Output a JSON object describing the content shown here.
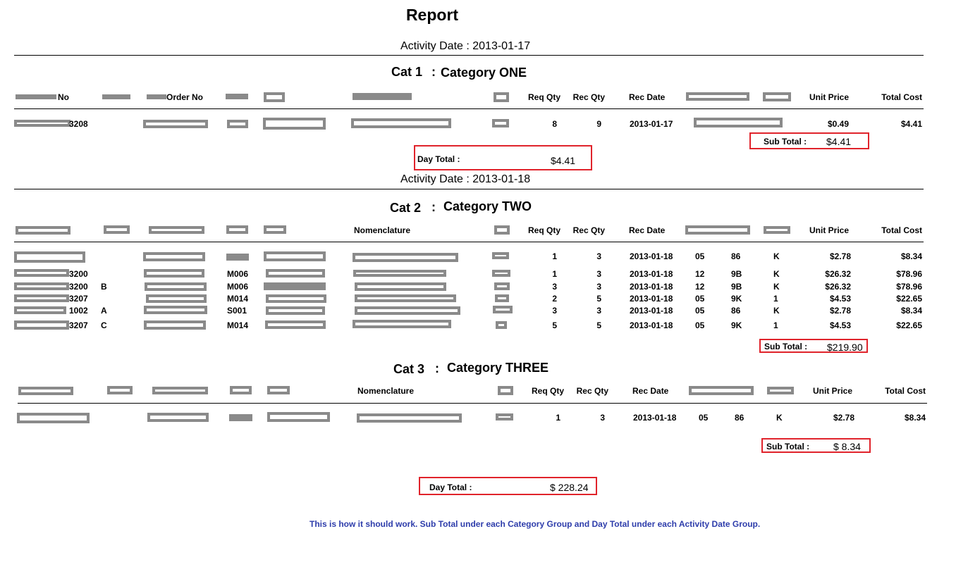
{
  "report": {
    "title": "Report"
  },
  "activity_dates": [
    "Activity Date : 2013-01-17",
    "Activity Date : 2013-01-18"
  ],
  "categories": [
    {
      "cat": "Cat 1",
      "sep": ":",
      "name": "Category ONE"
    },
    {
      "cat": "Cat 2",
      "sep": ":",
      "name": "Category TWO"
    },
    {
      "cat": "Cat 3",
      "sep": ":",
      "name": "Category THREE"
    }
  ],
  "headers": {
    "no": "No",
    "order_no": "Order No",
    "nomenclature": "Nomenclature",
    "req_qty": "Req Qty",
    "rec_qty": "Rec Qty",
    "rec_date": "Rec Date",
    "unit_price": "Unit Price",
    "total_cost": "Total Cost"
  },
  "group1": {
    "rows": [
      {
        "no": "3208",
        "req": "8",
        "rec": "9",
        "date": "2013-01-17",
        "unit": "$0.49",
        "total": "$4.41"
      }
    ],
    "subtotal_label": "Sub Total :",
    "subtotal": "$4.41",
    "daytotal_label": "Day Total :",
    "daytotal": "$4.41"
  },
  "group2": {
    "rows": [
      {
        "no": "",
        "suffix": "",
        "code": "",
        "req": "1",
        "rec": "3",
        "date": "2013-01-18",
        "a": "05",
        "b": "86",
        "c": "K",
        "unit": "$2.78",
        "total": "$8.34"
      },
      {
        "no": "3200",
        "suffix": "",
        "code": "M006",
        "req": "1",
        "rec": "3",
        "date": "2013-01-18",
        "a": "12",
        "b": "9B",
        "c": "K",
        "unit": "$26.32",
        "total": "$78.96"
      },
      {
        "no": "3200",
        "suffix": "B",
        "code": "M006",
        "req": "3",
        "rec": "3",
        "date": "2013-01-18",
        "a": "12",
        "b": "9B",
        "c": "K",
        "unit": "$26.32",
        "total": "$78.96"
      },
      {
        "no": "3207",
        "suffix": "",
        "code": "M014",
        "req": "2",
        "rec": "5",
        "date": "2013-01-18",
        "a": "05",
        "b": "9K",
        "c": "1",
        "unit": "$4.53",
        "total": "$22.65"
      },
      {
        "no": "1002",
        "suffix": "A",
        "code": "S001",
        "req": "3",
        "rec": "3",
        "date": "2013-01-18",
        "a": "05",
        "b": "86",
        "c": "K",
        "unit": "$2.78",
        "total": "$8.34"
      },
      {
        "no": "3207",
        "suffix": "C",
        "code": "M014",
        "req": "5",
        "rec": "5",
        "date": "2013-01-18",
        "a": "05",
        "b": "9K",
        "c": "1",
        "unit": "$4.53",
        "total": "$22.65"
      }
    ],
    "subtotal_label": "Sub Total :",
    "subtotal": "$219.90"
  },
  "group3": {
    "rows": [
      {
        "req": "1",
        "rec": "3",
        "date": "2013-01-18",
        "a": "05",
        "b": "86",
        "c": "K",
        "unit": "$2.78",
        "total": "$8.34"
      }
    ],
    "subtotal_label": "Sub Total :",
    "subtotal": "$ 8.34",
    "daytotal_label": "Day Total :",
    "daytotal": "$ 228.24"
  },
  "note": "This is how it should work. Sub Total under each Category Group and Day Total under each Activity Date Group."
}
